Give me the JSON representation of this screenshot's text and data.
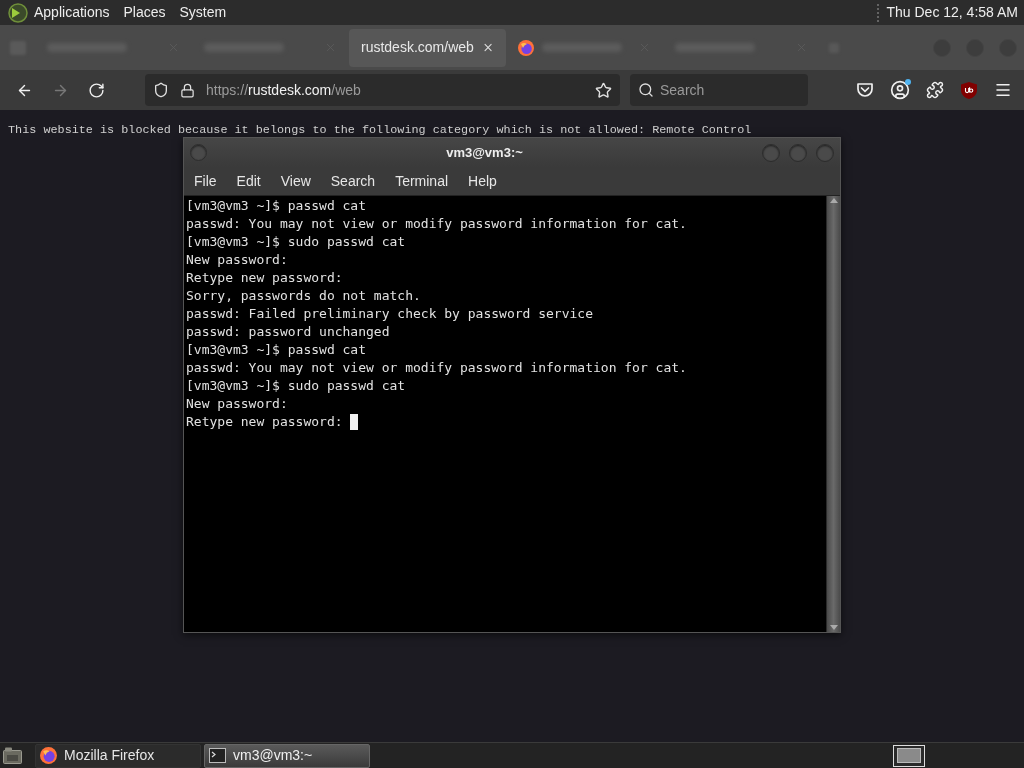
{
  "top_panel": {
    "menus": [
      "Applications",
      "Places",
      "System"
    ],
    "clock": "Thu Dec 12, 4:58 AM"
  },
  "browser": {
    "tabs": [
      {
        "selected": false,
        "favicon": false
      },
      {
        "selected": false,
        "favicon": false
      },
      {
        "label": "rustdesk.com/web",
        "selected": true,
        "favicon": false
      },
      {
        "selected": false,
        "favicon": true
      },
      {
        "selected": false,
        "favicon": false
      }
    ],
    "nav": {
      "buttons": [
        {
          "kind": "back",
          "disabled": false
        },
        {
          "kind": "forward",
          "disabled": true
        },
        {
          "kind": "reload",
          "disabled": false
        }
      ],
      "url": {
        "scheme": "https://",
        "host": "rustdesk.com",
        "path": "/web"
      },
      "search_placeholder": "Search"
    },
    "page": {
      "message": "This website is blocked because it belongs to the following category which is not allowed: Remote Control"
    }
  },
  "terminal": {
    "title": "vm3@vm3:~",
    "menus": [
      "File",
      "Edit",
      "View",
      "Search",
      "Terminal",
      "Help"
    ],
    "lines": [
      "[vm3@vm3 ~]$ passwd cat",
      "passwd: You may not view or modify password information for cat.",
      "[vm3@vm3 ~]$ sudo passwd cat",
      "New password:",
      "Retype new password:",
      "Sorry, passwords do not match.",
      "passwd: Failed preliminary check by password service",
      "passwd: password unchanged",
      "[vm3@vm3 ~]$ passwd cat",
      "passwd: You may not view or modify password information for cat.",
      "[vm3@vm3 ~]$ sudo passwd cat",
      "New password:",
      "Retype new password: "
    ],
    "cursor": true
  },
  "taskbar": {
    "tasks": [
      {
        "label": "Mozilla Firefox",
        "selected": false
      },
      {
        "label": "vm3@vm3:~",
        "selected": true
      }
    ]
  }
}
